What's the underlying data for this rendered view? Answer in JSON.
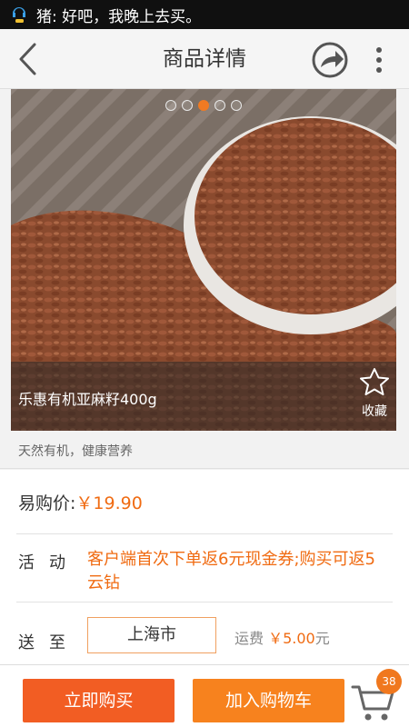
{
  "status_bar": {
    "notification": "猪: 好吧，我晚上去买。",
    "icon": "chat-notification-icon"
  },
  "header": {
    "title": "商品详情",
    "back_icon": "back-arrow-icon",
    "share_icon": "share-icon",
    "more_icon": "more-vertical-icon"
  },
  "gallery": {
    "product_name": "乐惠有机亚麻籽400g",
    "favorite_label": "收藏",
    "total_images": 5,
    "active_index": 2
  },
  "subtitle": "天然有机，健康营养",
  "details": {
    "price_label": "易购价:",
    "price_value": "￥19.90",
    "activity_label": "活动",
    "activity_text": "客户端首次下单返6元现金券;购买可返5云钻",
    "ship_label": "送至",
    "ship_city": "上海市",
    "shipping_prefix": "运费",
    "shipping_fee": "￥5.00",
    "shipping_unit": "元"
  },
  "actions": {
    "buy_now": "立即购买",
    "add_to_cart": "加入购物车",
    "cart_count": "38"
  },
  "colors": {
    "accent": "#f06b12",
    "buy_button": "#f25d23",
    "cart_button": "#f7821e",
    "active_dot": "#f07a22"
  }
}
